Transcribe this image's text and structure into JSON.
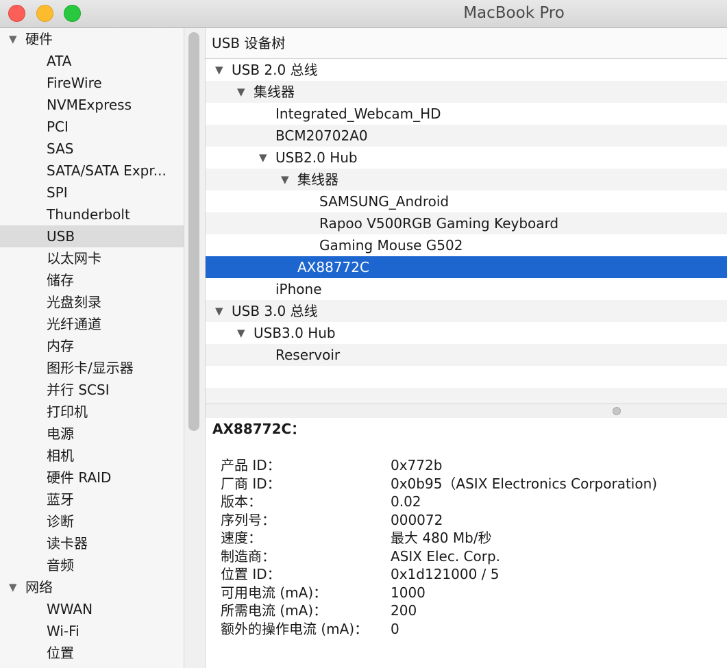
{
  "window": {
    "title": "MacBook Pro"
  },
  "sidebar": {
    "rows": [
      {
        "type": "group",
        "label": "硬件"
      },
      {
        "type": "item",
        "label": "ATA"
      },
      {
        "type": "item",
        "label": "FireWire"
      },
      {
        "type": "item",
        "label": "NVMExpress"
      },
      {
        "type": "item",
        "label": "PCI"
      },
      {
        "type": "item",
        "label": "SAS"
      },
      {
        "type": "item",
        "label": "SATA/SATA Expr..."
      },
      {
        "type": "item",
        "label": "SPI"
      },
      {
        "type": "item",
        "label": "Thunderbolt"
      },
      {
        "type": "item",
        "label": "USB",
        "selected": true
      },
      {
        "type": "item",
        "label": "以太网卡"
      },
      {
        "type": "item",
        "label": "储存"
      },
      {
        "type": "item",
        "label": "光盘刻录"
      },
      {
        "type": "item",
        "label": "光纤通道"
      },
      {
        "type": "item",
        "label": "内存"
      },
      {
        "type": "item",
        "label": "图形卡/显示器"
      },
      {
        "type": "item",
        "label": "并行 SCSI"
      },
      {
        "type": "item",
        "label": "打印机"
      },
      {
        "type": "item",
        "label": "电源"
      },
      {
        "type": "item",
        "label": "相机"
      },
      {
        "type": "item",
        "label": "硬件 RAID"
      },
      {
        "type": "item",
        "label": "蓝牙"
      },
      {
        "type": "item",
        "label": "诊断"
      },
      {
        "type": "item",
        "label": "读卡器"
      },
      {
        "type": "item",
        "label": "音频"
      },
      {
        "type": "group",
        "label": "网络"
      },
      {
        "type": "item",
        "label": "WWAN"
      },
      {
        "type": "item",
        "label": "Wi-Fi"
      },
      {
        "type": "item",
        "label": "位置"
      }
    ]
  },
  "tree": {
    "header": "USB 设备树",
    "rows": [
      {
        "label": "USB 2.0 总线",
        "depth": 0,
        "expanded": true
      },
      {
        "label": "集线器",
        "depth": 1,
        "expanded": true
      },
      {
        "label": "Integrated_Webcam_HD",
        "depth": 2
      },
      {
        "label": "BCM20702A0",
        "depth": 2
      },
      {
        "label": "USB2.0 Hub",
        "depth": 2,
        "expanded": true
      },
      {
        "label": "集线器",
        "depth": 3,
        "expanded": true
      },
      {
        "label": "SAMSUNG_Android",
        "depth": 4
      },
      {
        "label": "Rapoo V500RGB Gaming Keyboard",
        "depth": 4
      },
      {
        "label": "Gaming Mouse G502",
        "depth": 4
      },
      {
        "label": "AX88772C",
        "depth": 3,
        "selected": true
      },
      {
        "label": "iPhone",
        "depth": 2
      },
      {
        "label": "USB 3.0 总线",
        "depth": 0,
        "expanded": true
      },
      {
        "label": "USB3.0 Hub",
        "depth": 1,
        "expanded": true
      },
      {
        "label": "Reservoir",
        "depth": 2
      }
    ]
  },
  "detail": {
    "title": "AX88772C：",
    "properties": [
      {
        "key": "产品 ID：",
        "value": "0x772b"
      },
      {
        "key": "厂商 ID：",
        "value": "0x0b95（ASIX Electronics Corporation)"
      },
      {
        "key": "版本：",
        "value": "0.02"
      },
      {
        "key": "序列号：",
        "value": "000072"
      },
      {
        "key": "速度：",
        "value": "最大 480 Mb/秒"
      },
      {
        "key": "制造商：",
        "value": "ASIX Elec. Corp."
      },
      {
        "key": "位置 ID：",
        "value": "0x1d121000 / 5"
      },
      {
        "key": "可用电流 (mA)：",
        "value": "1000"
      },
      {
        "key": "所需电流 (mA)：",
        "value": "200"
      },
      {
        "key": "额外的操作电流 (mA)：",
        "value": "0"
      }
    ]
  }
}
